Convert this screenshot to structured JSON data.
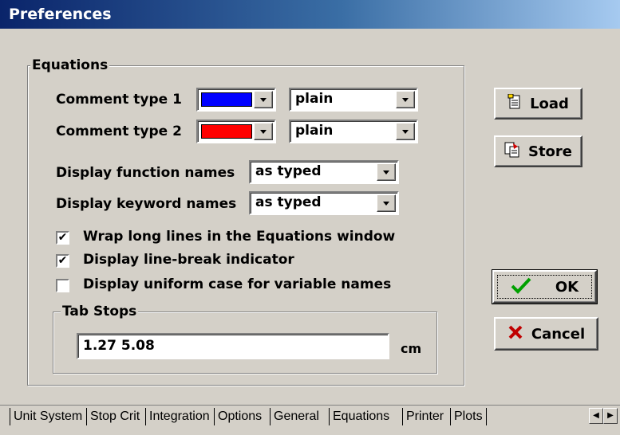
{
  "window": {
    "title": "Preferences"
  },
  "equations_group": {
    "label": "Equations",
    "comment1": {
      "label": "Comment type 1",
      "color": "#0000ff",
      "style": "plain"
    },
    "comment2": {
      "label": "Comment type 2",
      "color": "#ff0000",
      "style": "plain"
    },
    "function_names": {
      "label": "Display function names",
      "value": "as typed"
    },
    "keyword_names": {
      "label": "Display keyword names",
      "value": "as typed"
    },
    "checkboxes": [
      {
        "label": "Wrap long lines in the Equations window",
        "checked": true
      },
      {
        "label": "Display line-break indicator",
        "checked": true
      },
      {
        "label": "Display uniform case for variable names",
        "checked": false
      }
    ],
    "tab_stops": {
      "label": "Tab Stops",
      "value": "1.27 5.08",
      "unit": "cm"
    }
  },
  "buttons": {
    "load": "Load",
    "store": "Store",
    "ok": "OK",
    "cancel": "Cancel"
  },
  "tabs": [
    "Unit System",
    "Stop Crit",
    "Integration",
    "Options",
    "General",
    "Equations",
    "Printer",
    "Plots"
  ],
  "selected_tab": "Equations",
  "icons": {
    "load": "load-file-icon",
    "store": "store-file-icon",
    "ok": "checkmark-icon",
    "cancel": "x-icon",
    "check": "check-mark-icon"
  }
}
